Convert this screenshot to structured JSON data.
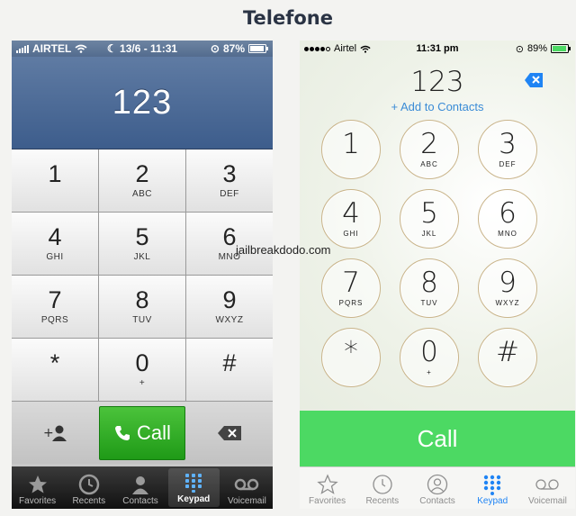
{
  "page_title": "Telefone",
  "watermark": "jailbreakdodo.com",
  "ios6": {
    "statusbar": {
      "carrier": "AIRTEL",
      "datetime": "13/6 - 11:31",
      "battery": "87%"
    },
    "display_number": "123",
    "keys": [
      {
        "num": "1",
        "letters": ""
      },
      {
        "num": "2",
        "letters": "ABC"
      },
      {
        "num": "3",
        "letters": "DEF"
      },
      {
        "num": "4",
        "letters": "GHI"
      },
      {
        "num": "5",
        "letters": "JKL"
      },
      {
        "num": "6",
        "letters": "MNO"
      },
      {
        "num": "7",
        "letters": "PQRS"
      },
      {
        "num": "8",
        "letters": "TUV"
      },
      {
        "num": "9",
        "letters": "WXYZ"
      },
      {
        "num": "*",
        "letters": ""
      },
      {
        "num": "0",
        "letters": "+"
      },
      {
        "num": "#",
        "letters": ""
      }
    ],
    "call_label": "Call",
    "tabs": [
      {
        "label": "Favorites",
        "icon": "star-icon"
      },
      {
        "label": "Recents",
        "icon": "clock-icon"
      },
      {
        "label": "Contacts",
        "icon": "person-icon"
      },
      {
        "label": "Keypad",
        "icon": "keypad-icon",
        "active": true
      },
      {
        "label": "Voicemail",
        "icon": "voicemail-icon"
      }
    ]
  },
  "ios7": {
    "statusbar": {
      "carrier": "Airtel",
      "time": "11:31 pm",
      "battery": "89%"
    },
    "display_number": "123",
    "add_contact": "+ Add to Contacts",
    "keys": [
      {
        "num": "1",
        "letters": ""
      },
      {
        "num": "2",
        "letters": "ABC"
      },
      {
        "num": "3",
        "letters": "DEF"
      },
      {
        "num": "4",
        "letters": "GHI"
      },
      {
        "num": "5",
        "letters": "JKL"
      },
      {
        "num": "6",
        "letters": "MNO"
      },
      {
        "num": "7",
        "letters": "PQRS"
      },
      {
        "num": "8",
        "letters": "TUV"
      },
      {
        "num": "9",
        "letters": "WXYZ"
      },
      {
        "num": "*",
        "letters": ""
      },
      {
        "num": "0",
        "letters": "+"
      },
      {
        "num": "#",
        "letters": ""
      }
    ],
    "call_label": "Call",
    "tabs": [
      {
        "label": "Favorites",
        "icon": "star-icon"
      },
      {
        "label": "Recents",
        "icon": "clock-icon"
      },
      {
        "label": "Contacts",
        "icon": "person-icon"
      },
      {
        "label": "Keypad",
        "icon": "keypad-icon",
        "active": true
      },
      {
        "label": "Voicemail",
        "icon": "voicemail-icon"
      }
    ]
  },
  "colors": {
    "ios6_call": "#2aa622",
    "ios7_call": "#4cd963",
    "ios7_accent": "#1f84f4",
    "ios7_link": "#3a8bd6"
  }
}
